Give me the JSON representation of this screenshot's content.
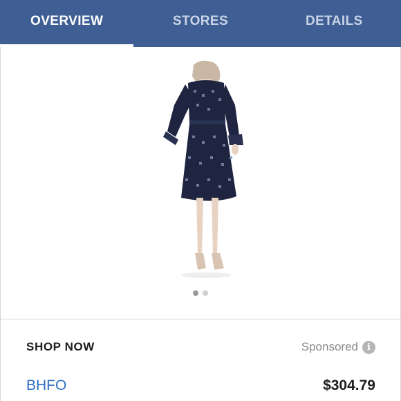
{
  "tabs": [
    {
      "label": "OVERVIEW",
      "active": true
    },
    {
      "label": "STORES",
      "active": false
    },
    {
      "label": "DETAILS",
      "active": false
    }
  ],
  "product": {
    "image_icon": "dress-product-image",
    "carousel_count": 2,
    "carousel_active_index": 0
  },
  "shop": {
    "title": "SHOP NOW",
    "sponsored_label": "Sponsored",
    "info_glyph": "i"
  },
  "offers": [
    {
      "store": "BHFO",
      "price": "$304.79"
    }
  ],
  "colors": {
    "header_bg": "#3f5f94",
    "link": "#2f6ec2"
  }
}
